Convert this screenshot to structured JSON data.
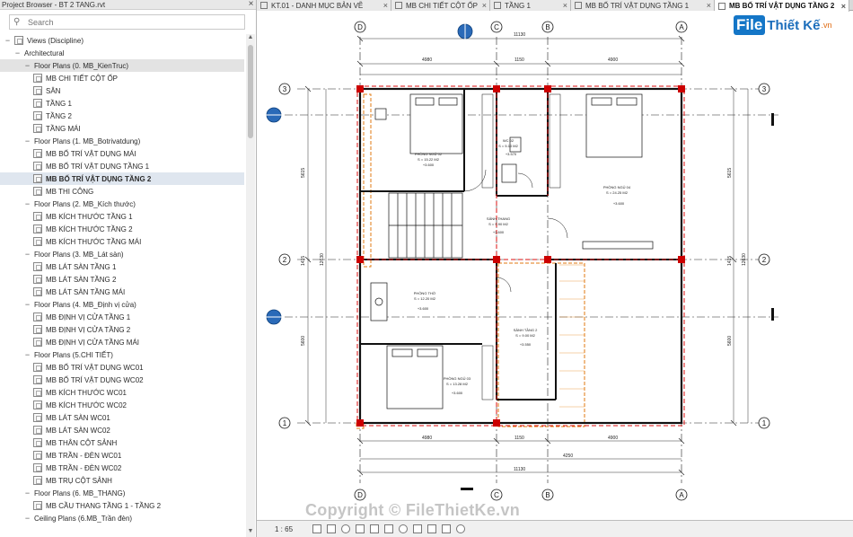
{
  "browser": {
    "title": "Project Browser - BT 2 TANG.rvt",
    "search_placeholder": "Search",
    "items": [
      {
        "label": "Views (Discipline)",
        "indent": 1,
        "kind": "root"
      },
      {
        "label": "Architectural",
        "indent": 2,
        "kind": "group"
      },
      {
        "label": "Floor Plans (0. MB_KienTruc)",
        "indent": 3,
        "kind": "group",
        "hl": true
      },
      {
        "label": "MB CHI TIẾT CỘT ỐP",
        "indent": 4,
        "kind": "view"
      },
      {
        "label": "SÂN",
        "indent": 4,
        "kind": "view"
      },
      {
        "label": "TẦNG 1",
        "indent": 4,
        "kind": "view"
      },
      {
        "label": "TẦNG 2",
        "indent": 4,
        "kind": "view"
      },
      {
        "label": "TẦNG MÁI",
        "indent": 4,
        "kind": "view"
      },
      {
        "label": "Floor Plans (1. MB_Botrivatdung)",
        "indent": 3,
        "kind": "group"
      },
      {
        "label": "MB BỐ TRÍ VẬT DỤNG MÁI",
        "indent": 4,
        "kind": "view"
      },
      {
        "label": "MB BỐ TRÍ VẬT DỤNG TẦNG 1",
        "indent": 4,
        "kind": "view"
      },
      {
        "label": "MB BỐ TRÍ VẬT DỤNG TẦNG 2",
        "indent": 4,
        "kind": "view",
        "sel": true
      },
      {
        "label": "MB THI CÔNG",
        "indent": 4,
        "kind": "view"
      },
      {
        "label": "Floor Plans (2. MB_Kích thước)",
        "indent": 3,
        "kind": "group"
      },
      {
        "label": "MB KÍCH THƯỚC TẦNG 1",
        "indent": 4,
        "kind": "view"
      },
      {
        "label": "MB KÍCH THƯỚC TẦNG 2",
        "indent": 4,
        "kind": "view"
      },
      {
        "label": "MB KÍCH THƯỚC TẦNG MÁI",
        "indent": 4,
        "kind": "view"
      },
      {
        "label": "Floor Plans (3. MB_Lát sàn)",
        "indent": 3,
        "kind": "group"
      },
      {
        "label": "MB LÁT SÀN TẦNG 1",
        "indent": 4,
        "kind": "view"
      },
      {
        "label": "MB LÁT SÀN TẦNG 2",
        "indent": 4,
        "kind": "view"
      },
      {
        "label": "MB LÁT SÀN TẦNG MÁI",
        "indent": 4,
        "kind": "view"
      },
      {
        "label": "Floor Plans (4. MB_Định vị cửa)",
        "indent": 3,
        "kind": "group"
      },
      {
        "label": "MB ĐỊNH VỊ CỬA TẦNG 1",
        "indent": 4,
        "kind": "view"
      },
      {
        "label": "MB ĐỊNH VỊ CỬA TẦNG 2",
        "indent": 4,
        "kind": "view"
      },
      {
        "label": "MB ĐỊNH VỊ CỬA TẦNG MÁI",
        "indent": 4,
        "kind": "view"
      },
      {
        "label": "Floor Plans (5.CHI TIẾT)",
        "indent": 3,
        "kind": "group"
      },
      {
        "label": "MB BỐ TRÍ VẬT DỤNG WC01",
        "indent": 4,
        "kind": "view"
      },
      {
        "label": "MB BỐ TRÍ VẬT DỤNG WC02",
        "indent": 4,
        "kind": "view"
      },
      {
        "label": "MB KÍCH THƯỚC WC01",
        "indent": 4,
        "kind": "view"
      },
      {
        "label": "MB KÍCH THƯỚC WC02",
        "indent": 4,
        "kind": "view"
      },
      {
        "label": "MB LÁT SÀN WC01",
        "indent": 4,
        "kind": "view"
      },
      {
        "label": "MB LÁT SÀN WC02",
        "indent": 4,
        "kind": "view"
      },
      {
        "label": "MB THÂN CỘT SẢNH",
        "indent": 4,
        "kind": "view"
      },
      {
        "label": "MB TRẦN - ĐÈN WC01",
        "indent": 4,
        "kind": "view"
      },
      {
        "label": "MB TRẦN - ĐÈN WC02",
        "indent": 4,
        "kind": "view"
      },
      {
        "label": "MB TRỤ CỘT SẢNH",
        "indent": 4,
        "kind": "view"
      },
      {
        "label": "Floor Plans (6. MB_THANG)",
        "indent": 3,
        "kind": "group"
      },
      {
        "label": "MB CẦU THANG TẦNG 1 - TẦNG 2",
        "indent": 4,
        "kind": "view"
      },
      {
        "label": "Ceiling Plans (6.MB_Trần đèn)",
        "indent": 3,
        "kind": "group"
      }
    ]
  },
  "tabs": [
    {
      "label": "KT.01 - DANH MỤC BẢN VẼ"
    },
    {
      "label": "MB CHI TIẾT CỘT ỐP"
    },
    {
      "label": "TẦNG 1"
    },
    {
      "label": "MB BỐ TRÍ VẬT DỤNG TẦNG 1"
    },
    {
      "label": "MB BỐ TRÍ VẬT DỤNG TẦNG 2",
      "active": true
    }
  ],
  "drawing": {
    "grid_top": [
      "D",
      "C",
      "B",
      "A"
    ],
    "grid_left": [
      "3",
      "2",
      "1"
    ],
    "dims": {
      "top_total": "11130",
      "top_a": "4980",
      "top_b": "1150",
      "top_c": "4900",
      "bottom_a": "4980",
      "bottom_b": "1150",
      "bottom_c": "4900",
      "bottom_d": "4250",
      "bottom_total": "11130",
      "left_1": "5615",
      "left_2": "1415",
      "left_3": "5600",
      "left_total": "12630",
      "right_1": "5615",
      "right_2": "1415",
      "right_3": "5600",
      "right_total": "12630"
    },
    "rooms": [
      {
        "name": "PHÒNG NGỦ 02",
        "area": "S = 15.22 M2",
        "level": "+3.600"
      },
      {
        "name": "WC 02",
        "area": "S = 5.10 M2",
        "level": "+3.570"
      },
      {
        "name": "PHÒNG NGỦ 04",
        "area": "S = 24.25 M2",
        "level": "+3.600"
      },
      {
        "name": "SẢNH THANG",
        "area": "S = 9.90 M2",
        "level": "+3.600"
      },
      {
        "name": "PHÒNG THỜ",
        "area": "S = 12.20 M2",
        "level": "+3.600"
      },
      {
        "name": "SẢNH TẦNG 2",
        "area": "S = 9.00 M2",
        "level": "+3.550"
      },
      {
        "name": "PHÒNG NGỦ 03",
        "area": "S = 13.28 M2",
        "level": "+3.600"
      }
    ]
  },
  "status": {
    "scale": "1 : 65"
  },
  "watermark": "Copyright © FileThietKe.vn",
  "logo": {
    "part1": "File",
    "part2": "Thiết Kế",
    "part3": ".vn"
  },
  "colors": {
    "wall": "#d11",
    "column": "#cc0000",
    "hatch": "#e07a10",
    "grid": "#111"
  }
}
